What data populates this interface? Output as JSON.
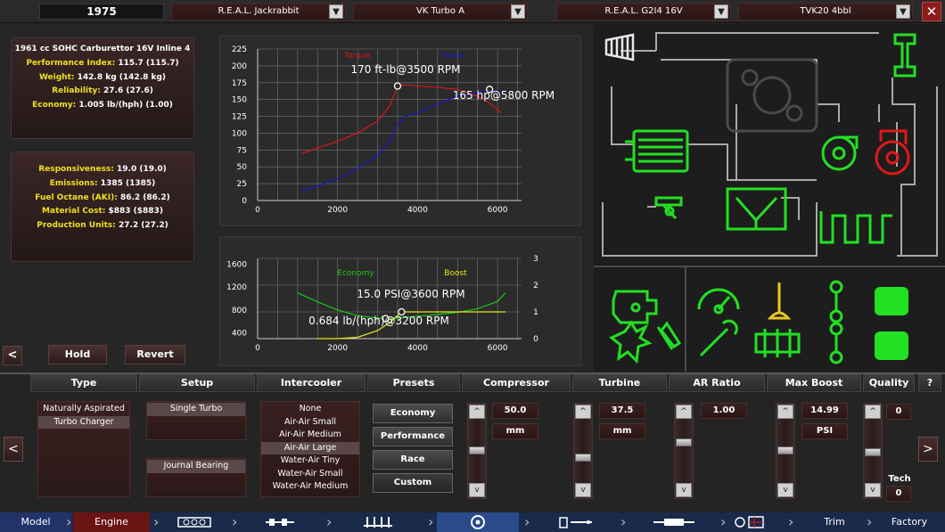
{
  "top": {
    "year": "1975",
    "dropdowns": [
      "R.E.A.L. Jackrabbit",
      "VK Turbo A",
      "R.E.A.L. G2I4 16V",
      "TVK20 4bbl"
    ],
    "close_label": "✕"
  },
  "stats1": {
    "engine": "1961 cc SOHC Carburettor 16V Inline 4",
    "rows": [
      {
        "label": "Performance Index:",
        "value": " 115.7",
        "base": " (115.7)"
      },
      {
        "label": "Weight:",
        "value": " 142.8 kg",
        "base": " (142.8 kg)"
      },
      {
        "label": "Reliability:",
        "value": " 27.6",
        "base": " (27.6)"
      },
      {
        "label": "Economy:",
        "value": " 1.005 lb/(hph)",
        "base": " (1.00)"
      }
    ]
  },
  "stats2": {
    "rows": [
      {
        "label": "Responsiveness:",
        "value": " 19.0",
        "base": " (19.0)"
      },
      {
        "label": "Emissions:",
        "value": " 1385",
        "base": " (1385)"
      },
      {
        "label": "Fuel Octane (AKI):",
        "value": " 86.2",
        "base": " (86.2)"
      },
      {
        "label": "Material Cost:",
        "value": " $883",
        "base": " ($883)"
      },
      {
        "label": "Production Units:",
        "value": " 27.2",
        "base": " (27.2)"
      }
    ]
  },
  "buttons": {
    "back": "<",
    "hold": "Hold",
    "revert": "Revert"
  },
  "chart_data": [
    {
      "type": "line",
      "series": [
        {
          "name": "Torque",
          "color": "#d81818",
          "x": [
            1100,
            1500,
            2000,
            2500,
            3000,
            3300,
            3500,
            3700,
            4000,
            4500,
            5000,
            5500,
            5800,
            6100
          ],
          "y": [
            70,
            78,
            88,
            100,
            118,
            140,
            170,
            172,
            170,
            168,
            165,
            155,
            145,
            130
          ]
        },
        {
          "name": "Power",
          "color": "#1818c8",
          "x": [
            1100,
            1500,
            2000,
            2500,
            3000,
            3300,
            3500,
            3700,
            4000,
            4500,
            5000,
            5500,
            5800,
            6100
          ],
          "y": [
            14,
            22,
            32,
            48,
            67,
            88,
            113,
            125,
            130,
            143,
            155,
            160,
            165,
            160
          ]
        }
      ],
      "xticks": [
        "0",
        "2000",
        "4000",
        "6000"
      ],
      "yticks": [
        "0",
        "25",
        "50",
        "75",
        "100",
        "125",
        "150",
        "175",
        "200",
        "225"
      ],
      "xlim": [
        0,
        6600
      ],
      "ylim": [
        0,
        225
      ],
      "annotations": [
        "170 ft-lb@3500 RPM",
        "165 hp@5800 RPM"
      ]
    },
    {
      "type": "line",
      "series": [
        {
          "name": "Economy",
          "color": "#18c818",
          "axis": "left",
          "x": [
            1000,
            1500,
            2000,
            2500,
            3000,
            3200,
            3500,
            4000,
            4500,
            5000,
            5500,
            6000,
            6200
          ],
          "y": [
            1100,
            940,
            800,
            700,
            660,
            650,
            660,
            690,
            720,
            760,
            820,
            950,
            1100
          ]
        },
        {
          "name": "Boost",
          "color": "#e8e818",
          "axis": "right",
          "x": [
            1500,
            2000,
            2500,
            3000,
            3300,
            3600,
            4000,
            4500,
            5000,
            5500,
            6000,
            6200
          ],
          "y": [
            0,
            0,
            0.05,
            0.3,
            0.6,
            1.0,
            1.0,
            1.0,
            1.0,
            1.0,
            1.0,
            1.0
          ]
        }
      ],
      "xticks": [
        "0",
        "2000",
        "4000",
        "6000"
      ],
      "yticks_left": [
        "400",
        "800",
        "1200",
        "1600"
      ],
      "yticks_right": [
        "0",
        "1",
        "2",
        "3"
      ],
      "xlim": [
        0,
        6600
      ],
      "ylim_left": [
        300,
        1700
      ],
      "ylim_right": [
        0,
        3
      ],
      "annotations": [
        "15.0 PSI@3600 RPM",
        "0.684 lb/(hph)@3200 RPM"
      ]
    }
  ],
  "bottom": {
    "headers": [
      "Type",
      "Setup",
      "Intercooler",
      "Presets",
      "Compressor",
      "Turbine",
      "AR Ratio",
      "Max Boost",
      "Quality"
    ],
    "help": "?",
    "type_items": [
      "Naturally Aspirated",
      "Turbo Charger"
    ],
    "setup_items": [
      "Single Turbo",
      "Journal Bearing"
    ],
    "intercooler_items": [
      "None",
      "Air-Air Small",
      "Air-Air Medium",
      "Air-Air Large",
      "Water-Air Tiny",
      "Water-Air Small",
      "Water-Air Medium"
    ],
    "presets": [
      "Economy",
      "Performance",
      "Race",
      "Custom"
    ],
    "compressor": {
      "value": "50.0",
      "unit": "mm",
      "level": 0.52
    },
    "turbine": {
      "value": "37.5",
      "unit": "mm",
      "level": 0.4
    },
    "ar_ratio": {
      "value": "1.00",
      "level": 0.67
    },
    "max_boost": {
      "value": "14.99",
      "unit": "PSI",
      "level": 0.52
    },
    "quality": {
      "value": "0",
      "tech_label": "Tech",
      "tech_value": "0",
      "level": 0.5
    },
    "prev": "<",
    "next": ">",
    "up": "^",
    "down": "v"
  },
  "nav": {
    "items": [
      "Model",
      "Engine",
      "Trim",
      "Factory"
    ],
    "separator": "›"
  },
  "colors": {
    "accent_yellow": "#f0e020",
    "active_green": "#22e022",
    "turbo_red": "#e01818",
    "nav_blue": "#1a2a4a"
  }
}
